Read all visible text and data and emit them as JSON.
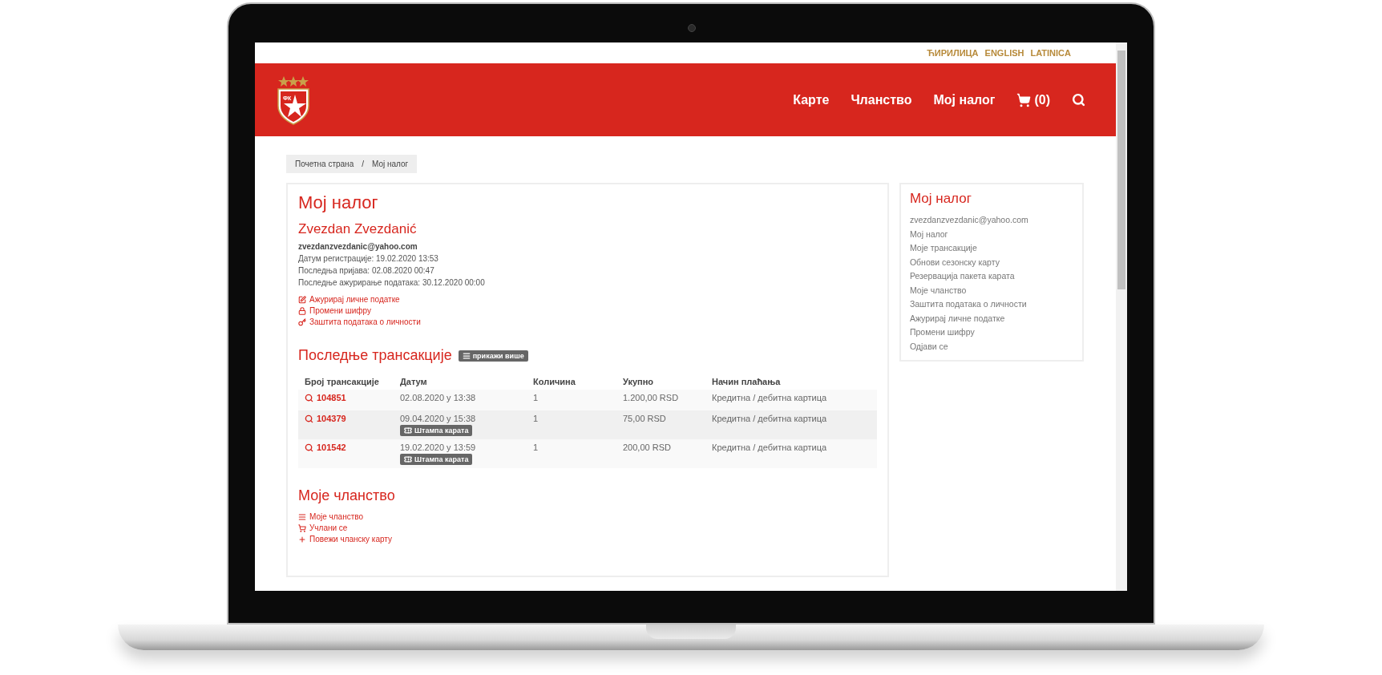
{
  "languages": [
    "ЋИРИЛИЦА",
    "ENGLISH",
    "LATINICA"
  ],
  "logo": {
    "text": "ФК"
  },
  "nav": [
    "Карте",
    "Чланство",
    "Мој налог"
  ],
  "cart": {
    "count": "(0)"
  },
  "breadcrumb": [
    "Почетна страна",
    "/",
    "Мој налог"
  ],
  "account": {
    "title": "Мој налог",
    "name": "Zvezdan Zvezdanić",
    "email": "zvezdanzvezdanic@yahoo.com",
    "info": [
      "Датум регистрације: 19.02.2020 13:53",
      "Последња пријава: 02.08.2020 00:47",
      "Последње ажурирање података: 30.12.2020 00:00"
    ],
    "links": [
      {
        "kind": "edit",
        "label": "Ажурирај личне податке"
      },
      {
        "kind": "lock",
        "label": "Промени шифру"
      },
      {
        "kind": "key",
        "label": "Заштита података о личности"
      }
    ]
  },
  "transactions": {
    "title": "Последње трансакције",
    "more_button": "прикажи више",
    "columns": [
      "Број трансакције",
      "Датум",
      "Количина",
      "Укупно",
      "Начин плаћања"
    ],
    "rows": [
      {
        "id": "104851",
        "date": "02.08.2020 у 13:38",
        "quantity": "1",
        "total": "1.200,00 RSD",
        "payment": "Кредитна / дебитна картица"
      },
      {
        "id": "104379",
        "date": "09.04.2020 у 15:38",
        "print": "Штампа карата",
        "quantity": "1",
        "total": "75,00 RSD",
        "payment": "Кредитна / дебитна картица"
      },
      {
        "id": "101542",
        "date": "19.02.2020 у 13:59",
        "print": "Штампа карата",
        "quantity": "1",
        "total": "200,00 RSD",
        "payment": "Кредитна / дебитна картица"
      }
    ]
  },
  "membership": {
    "title": "Моје чланство",
    "links": [
      {
        "kind": "list",
        "label": "Моје чланство"
      },
      {
        "kind": "cart",
        "label": "Учлани се"
      },
      {
        "kind": "plus",
        "label": "Повежи чланску карту"
      }
    ]
  },
  "sidebar": {
    "title": "Мој налог",
    "items": [
      "zvezdanzvezdanic@yahoo.com",
      "Мој налог",
      "Моје трансакције",
      "Обнови сезонску карту",
      "Резервација пакета карата",
      "Моје чланство",
      "Заштита података о личности",
      "Ажурирај личне податке",
      "Промени шифру",
      "Одјави се"
    ]
  }
}
